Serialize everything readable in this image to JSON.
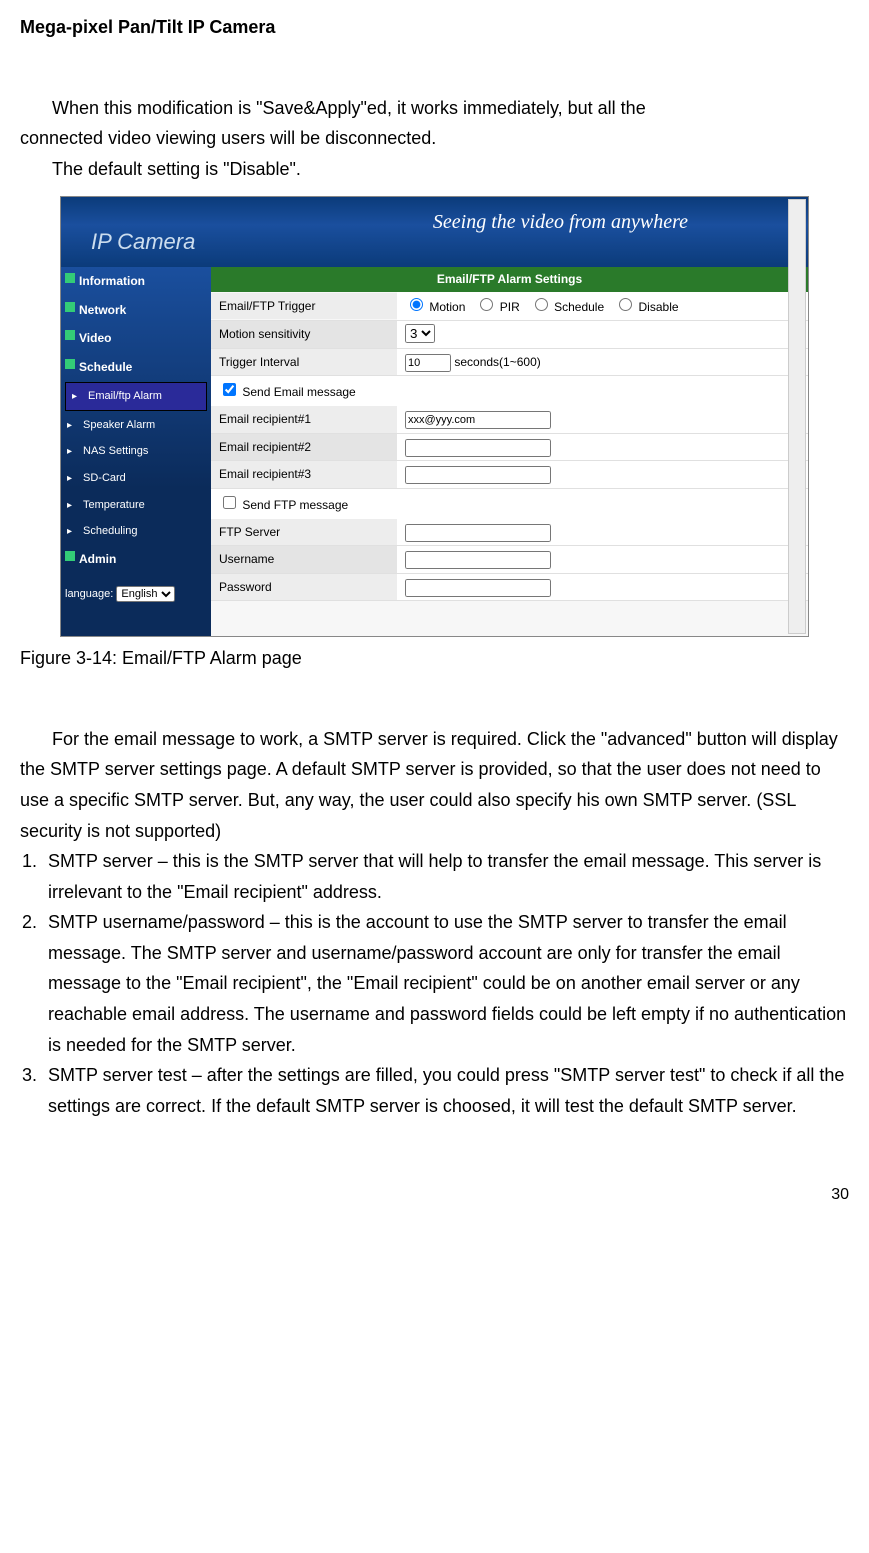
{
  "header": "Mega-pixel Pan/Tilt IP Camera",
  "para1a": "When this modification is \"Save&Apply\"ed, it works immediately, but all the",
  "para1b": "connected video viewing users will be disconnected.",
  "para2": "The default setting is \"Disable\".",
  "caption": "Figure 3-14: Email/FTP Alarm page",
  "para3": "For the email message to work, a SMTP server is required. Click the \"advanced\" button will display the SMTP server settings page. A default SMTP server is provided, so that the user does not need to use a specific SMTP server. But, any way, the user could also specify his own SMTP server. (SSL security is not supported)",
  "item1": "SMTP server – this is the SMTP server that will help to transfer the email message. This server is irrelevant to the \"Email recipient\" address.",
  "item2": "SMTP username/password – this is the account to use the SMTP server to transfer the email message. The SMTP server and username/password account are only for transfer the email message to the \"Email recipient\", the \"Email recipient\" could be on another email server or any reachable email address. The username and password fields could be left empty if no authentication is needed for the SMTP server.",
  "item3": "SMTP server test – after the settings are filled, you could press \"SMTP server test\" to check if all the settings are correct. If the default SMTP server is choosed, it will test the default SMTP server.",
  "page_number": "30",
  "ui": {
    "brand": "IP Camera",
    "slogan": "Seeing the video from anywhere",
    "nav": {
      "information": "Information",
      "network": "Network",
      "video": "Video",
      "schedule": "Schedule",
      "email": "Email/ftp Alarm",
      "speaker": "Speaker Alarm",
      "nas": "NAS Settings",
      "sdcard": "SD-Card",
      "temperature": "Temperature",
      "scheduling": "Scheduling",
      "admin": "Admin",
      "language_label": "language:",
      "language_value": "English"
    },
    "form": {
      "section": "Email/FTP Alarm Settings",
      "trigger_label": "Email/FTP Trigger",
      "trigger_options": {
        "motion": "Motion",
        "pir": "PIR",
        "schedule": "Schedule",
        "disable": "Disable"
      },
      "motion_label": "Motion sensitivity",
      "motion_value": "3",
      "interval_label": "Trigger Interval",
      "interval_value": "10",
      "interval_suffix": "seconds(1~600)",
      "send_email": "Send Email message",
      "recipient1": "Email recipient#1",
      "recipient1_value": "xxx@yyy.com",
      "recipient2": "Email recipient#2",
      "recipient3": "Email recipient#3",
      "send_ftp": "Send FTP message",
      "ftp_server": "FTP Server",
      "username": "Username",
      "password": "Password"
    }
  }
}
